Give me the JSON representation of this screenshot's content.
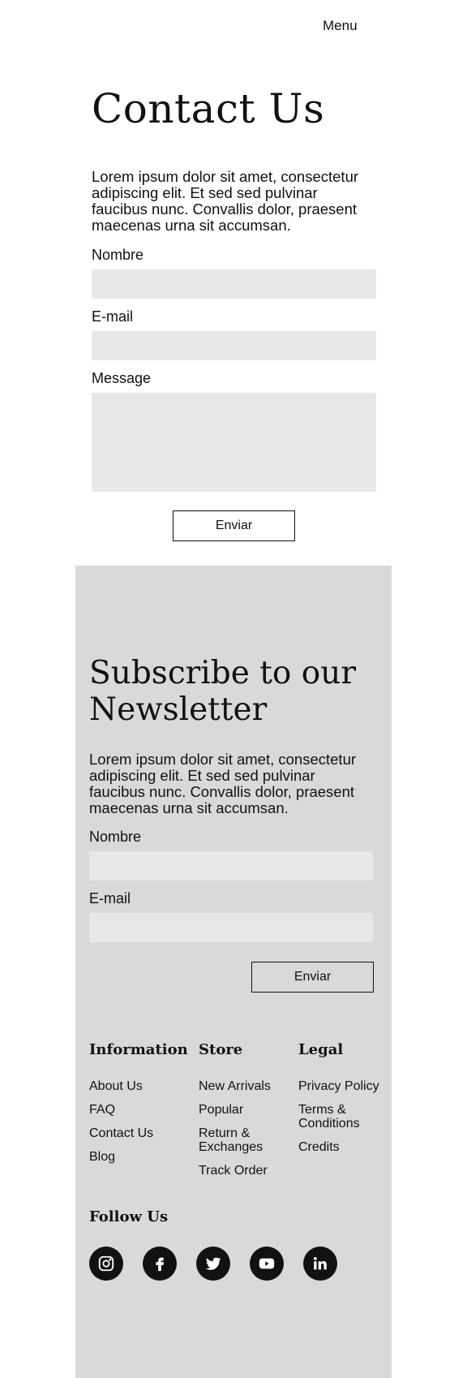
{
  "nav": {
    "menu_label": "Menu"
  },
  "contact": {
    "title": "Contact Us",
    "description": "Lorem ipsum dolor sit amet, consectetur adipiscing elit. Et sed sed pulvinar faucibus nunc. Convallis dolor, praesent maecenas urna sit accumsan.",
    "name_label": "Nombre",
    "name_value": "",
    "email_label": "E-mail",
    "email_value": "",
    "message_label": "Message",
    "message_value": "",
    "submit_label": "Enviar"
  },
  "newsletter": {
    "title": "Subscribe to our Newsletter",
    "description": "Lorem ipsum dolor sit amet, consectetur adipiscing elit. Et sed sed pulvinar faucibus nunc. Convallis dolor, praesent maecenas urna sit accumsan.",
    "name_label": "Nombre",
    "name_value": "",
    "email_label": "E-mail",
    "email_value": "",
    "submit_label": "Enviar"
  },
  "footer": {
    "columns": [
      {
        "heading": "Information",
        "links": [
          "About Us",
          "FAQ",
          "Contact Us",
          "Blog"
        ]
      },
      {
        "heading": "Store",
        "links": [
          "New Arrivals",
          "Popular",
          "Return & Exchanges",
          "Track Order"
        ]
      },
      {
        "heading": "Legal",
        "links": [
          "Privacy Policy",
          "Terms & Conditions",
          "Credits"
        ]
      }
    ],
    "follow_heading": "Follow Us",
    "socials": [
      "instagram-icon",
      "facebook-icon",
      "twitter-icon",
      "youtube-icon",
      "linkedin-icon"
    ]
  },
  "colors": {
    "background": "#ffffff",
    "footer_bg": "#d9d9d9",
    "field_bg": "#e8e8e8",
    "text": "#111111"
  }
}
